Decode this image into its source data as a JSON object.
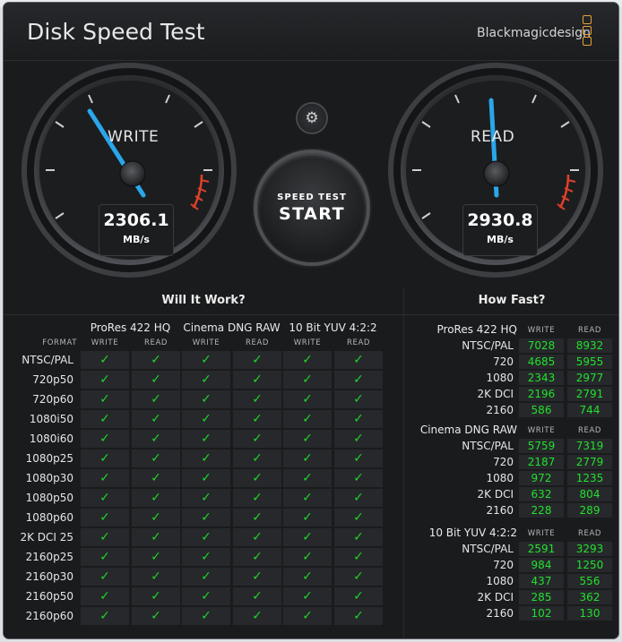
{
  "window": {
    "title": "Disk Speed Test",
    "brand": "Blackmagicdesign"
  },
  "gauges": {
    "write": {
      "label": "WRITE",
      "value": "2306.1",
      "unit": "MB/s"
    },
    "read": {
      "label": "READ",
      "value": "2930.8",
      "unit": "MB/s"
    }
  },
  "start_button": {
    "small": "SPEED TEST",
    "big": "START"
  },
  "settings_icon": "gear-icon",
  "will_it_work": {
    "title": "Will It Work?",
    "format_label": "FORMAT",
    "codecs": [
      "ProRes 422 HQ",
      "Cinema DNG RAW",
      "10 Bit YUV 4:2:2"
    ],
    "write_label": "WRITE",
    "read_label": "READ",
    "check": "✓",
    "rows": [
      "NTSC/PAL",
      "720p50",
      "720p60",
      "1080i50",
      "1080i60",
      "1080p25",
      "1080p30",
      "1080p50",
      "1080p60",
      "2K DCI 25",
      "2160p25",
      "2160p30",
      "2160p50",
      "2160p60"
    ]
  },
  "how_fast": {
    "title": "How Fast?",
    "write_label": "WRITE",
    "read_label": "READ",
    "groups": [
      {
        "codec": "ProRes 422 HQ",
        "rows": [
          {
            "label": "NTSC/PAL",
            "write": "7028",
            "read": "8932"
          },
          {
            "label": "720",
            "write": "4685",
            "read": "5955"
          },
          {
            "label": "1080",
            "write": "2343",
            "read": "2977"
          },
          {
            "label": "2K DCI",
            "write": "2196",
            "read": "2791"
          },
          {
            "label": "2160",
            "write": "586",
            "read": "744"
          }
        ]
      },
      {
        "codec": "Cinema DNG RAW",
        "rows": [
          {
            "label": "NTSC/PAL",
            "write": "5759",
            "read": "7319"
          },
          {
            "label": "720",
            "write": "2187",
            "read": "2779"
          },
          {
            "label": "1080",
            "write": "972",
            "read": "1235"
          },
          {
            "label": "2K DCI",
            "write": "632",
            "read": "804"
          },
          {
            "label": "2160",
            "write": "228",
            "read": "289"
          }
        ]
      },
      {
        "codec": "10 Bit YUV 4:2:2",
        "rows": [
          {
            "label": "NTSC/PAL",
            "write": "2591",
            "read": "3293"
          },
          {
            "label": "720",
            "write": "984",
            "read": "1250"
          },
          {
            "label": "1080",
            "write": "437",
            "read": "556"
          },
          {
            "label": "2K DCI",
            "write": "285",
            "read": "362"
          },
          {
            "label": "2160",
            "write": "102",
            "read": "130"
          }
        ]
      }
    ]
  },
  "colors": {
    "accent_blue": "#2aa6ea",
    "check_green": "#20d22a",
    "redline": "#e0402a",
    "brand_orange": "#e8a23a"
  }
}
